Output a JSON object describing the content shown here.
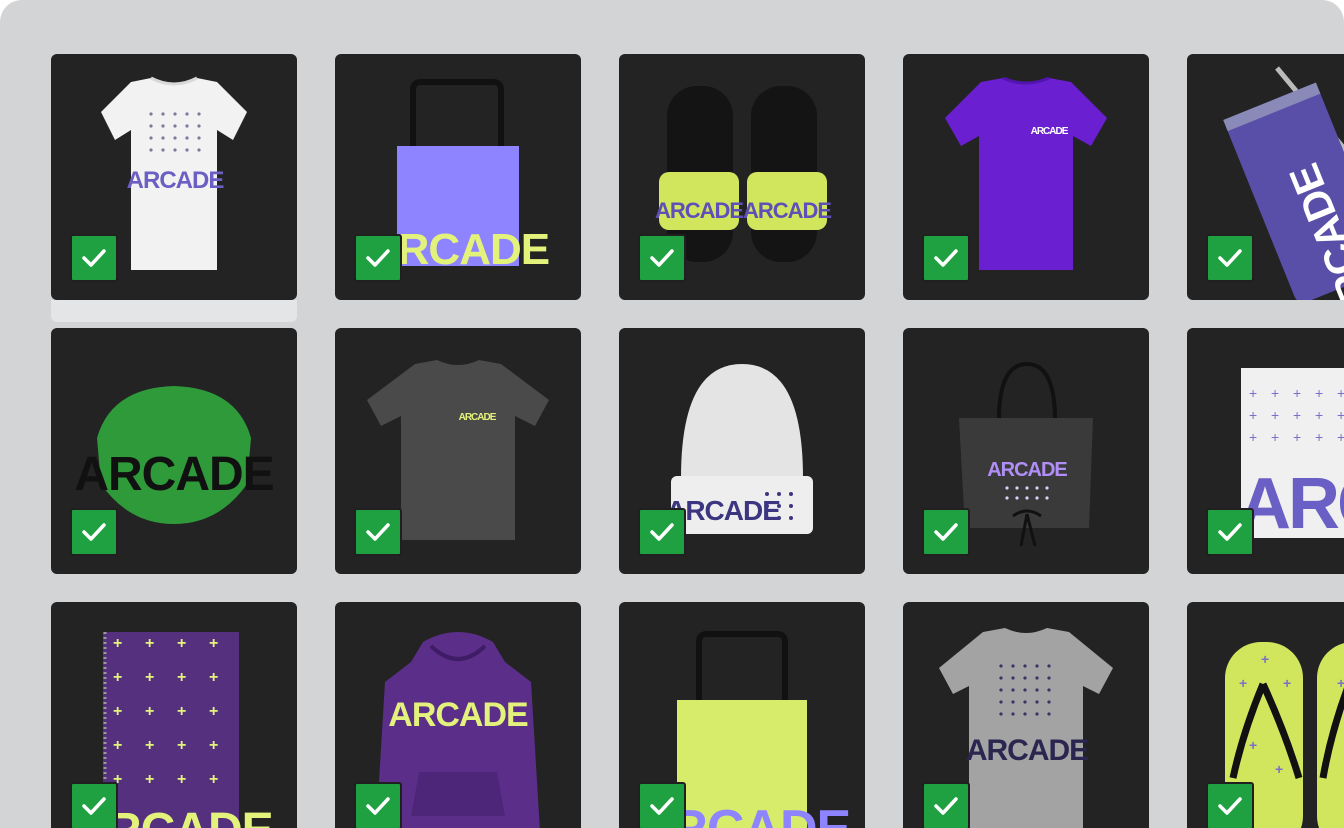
{
  "brand": "ARCADE",
  "check_icon": "checkmark-icon",
  "colors": {
    "frame_bg": "#d3d4d6",
    "tile_bg": "#232323",
    "check_bg": "#1fa142",
    "purple": "#6a3bd1",
    "lime": "#d6ec6a",
    "lavender": "#8f84ff"
  },
  "products": [
    {
      "name": "white-tshirt",
      "label": "ARCADE",
      "selected": true
    },
    {
      "name": "lavender-tote-bag",
      "label": "ARCADE",
      "selected": true
    },
    {
      "name": "lime-slides",
      "label": "ARCADE",
      "selected": true
    },
    {
      "name": "purple-tshirt",
      "label": "ARCADE",
      "selected": true
    },
    {
      "name": "purple-tumbler",
      "label": "ARCADE",
      "selected": true
    },
    {
      "name": "green-face-mask",
      "label": "ARCADE",
      "selected": true
    },
    {
      "name": "charcoal-tshirt",
      "label": "ARCADE",
      "selected": true
    },
    {
      "name": "white-beanie",
      "label": "ARCADE",
      "selected": true
    },
    {
      "name": "black-apron",
      "label": "ARCADE",
      "selected": true
    },
    {
      "name": "white-drawstring-bag",
      "label": "ARCADE",
      "selected": true
    },
    {
      "name": "purple-notebook",
      "label": "ARCADE",
      "selected": true
    },
    {
      "name": "purple-hoodie",
      "label": "ARCADE",
      "selected": true
    },
    {
      "name": "lime-tote-bag",
      "label": "ARCADE",
      "selected": true
    },
    {
      "name": "grey-tshirt",
      "label": "ARCADE",
      "selected": true
    },
    {
      "name": "lime-flip-flops",
      "label": "",
      "selected": true
    }
  ]
}
